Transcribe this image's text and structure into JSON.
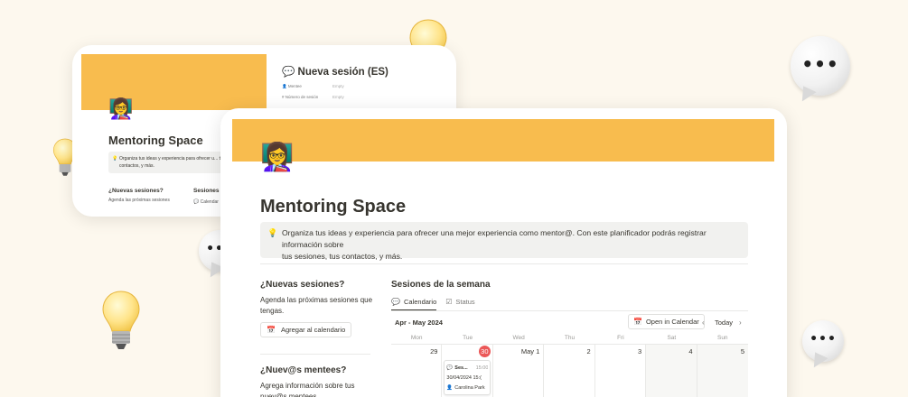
{
  "back_card": {
    "page_title": "Mentoring Space",
    "callout": "Organiza tus ideas y experiencia para ofrecer u... tus sesiones, tus contactos, y más.",
    "section1_title": "¿Nuevas sesiones?",
    "section1_text": "Agenda las próximas sesiones",
    "section2_title": "Sesiones",
    "section2_tab": "Calendar",
    "panel_title": "Nueva sesión (ES)",
    "props": [
      {
        "label": "Mentee",
        "value": "Empty"
      },
      {
        "label": "Número de sesión",
        "value": "Empty"
      }
    ]
  },
  "front_card": {
    "page_title": "Mentoring Space",
    "callout_line1": "Organiza tus ideas y experiencia para ofrecer una mejor experiencia como mentor@. Con este planificador podrás registrar información sobre",
    "callout_line2": "tus sesiones, tus contactos, y más.",
    "new_sessions": {
      "title": "¿Nuevas sesiones?",
      "text": "Agenda las próximas sesiones que tengas.",
      "button": "Agregar al calendario"
    },
    "new_mentees": {
      "title": "¿Nuev@s mentees?",
      "text": "Agrega información sobre tus nuev@s mentees"
    },
    "calendar": {
      "title": "Sesiones de la semana",
      "tabs": [
        {
          "label": "Calendario",
          "icon": "calendar-people-icon",
          "active": true
        },
        {
          "label": "Status",
          "icon": "checkbox-icon",
          "active": false
        }
      ],
      "month_label": "Apr - May 2024",
      "open_button": "Open in Calendar",
      "today_label": "Today",
      "weekdays": [
        "Mon",
        "Tue",
        "Wed",
        "Thu",
        "Fri",
        "Sat",
        "Sun"
      ],
      "days": [
        "29",
        "30",
        "May 1",
        "2",
        "3",
        "4",
        "5"
      ],
      "today_index": 1,
      "event": {
        "title": "Ses...",
        "time": "15:00",
        "date": "30/04/2024 15:(",
        "person": "Carolina Park"
      }
    }
  },
  "colors": {
    "cover": "#f8bc4e",
    "background": "#fdf8ee",
    "today": "#eb5757"
  }
}
